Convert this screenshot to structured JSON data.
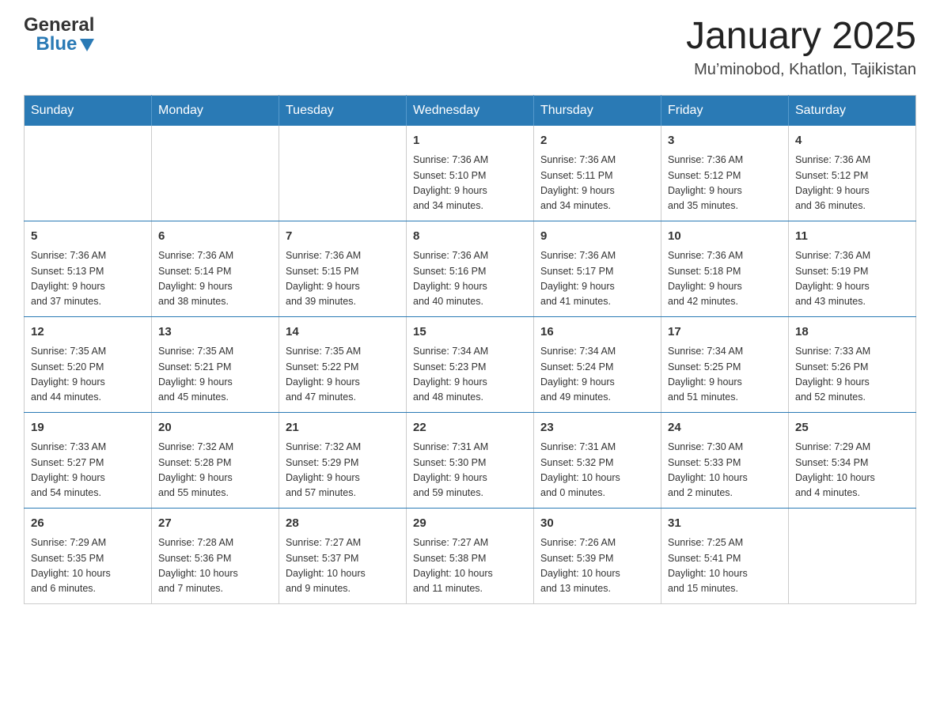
{
  "logo": {
    "general": "General",
    "blue": "Blue"
  },
  "title": "January 2025",
  "subtitle": "Mu’minobod, Khatlon, Tajikistan",
  "days_of_week": [
    "Sunday",
    "Monday",
    "Tuesday",
    "Wednesday",
    "Thursday",
    "Friday",
    "Saturday"
  ],
  "weeks": [
    [
      {
        "day": "",
        "info": ""
      },
      {
        "day": "",
        "info": ""
      },
      {
        "day": "",
        "info": ""
      },
      {
        "day": "1",
        "info": "Sunrise: 7:36 AM\nSunset: 5:10 PM\nDaylight: 9 hours\nand 34 minutes."
      },
      {
        "day": "2",
        "info": "Sunrise: 7:36 AM\nSunset: 5:11 PM\nDaylight: 9 hours\nand 34 minutes."
      },
      {
        "day": "3",
        "info": "Sunrise: 7:36 AM\nSunset: 5:12 PM\nDaylight: 9 hours\nand 35 minutes."
      },
      {
        "day": "4",
        "info": "Sunrise: 7:36 AM\nSunset: 5:12 PM\nDaylight: 9 hours\nand 36 minutes."
      }
    ],
    [
      {
        "day": "5",
        "info": "Sunrise: 7:36 AM\nSunset: 5:13 PM\nDaylight: 9 hours\nand 37 minutes."
      },
      {
        "day": "6",
        "info": "Sunrise: 7:36 AM\nSunset: 5:14 PM\nDaylight: 9 hours\nand 38 minutes."
      },
      {
        "day": "7",
        "info": "Sunrise: 7:36 AM\nSunset: 5:15 PM\nDaylight: 9 hours\nand 39 minutes."
      },
      {
        "day": "8",
        "info": "Sunrise: 7:36 AM\nSunset: 5:16 PM\nDaylight: 9 hours\nand 40 minutes."
      },
      {
        "day": "9",
        "info": "Sunrise: 7:36 AM\nSunset: 5:17 PM\nDaylight: 9 hours\nand 41 minutes."
      },
      {
        "day": "10",
        "info": "Sunrise: 7:36 AM\nSunset: 5:18 PM\nDaylight: 9 hours\nand 42 minutes."
      },
      {
        "day": "11",
        "info": "Sunrise: 7:36 AM\nSunset: 5:19 PM\nDaylight: 9 hours\nand 43 minutes."
      }
    ],
    [
      {
        "day": "12",
        "info": "Sunrise: 7:35 AM\nSunset: 5:20 PM\nDaylight: 9 hours\nand 44 minutes."
      },
      {
        "day": "13",
        "info": "Sunrise: 7:35 AM\nSunset: 5:21 PM\nDaylight: 9 hours\nand 45 minutes."
      },
      {
        "day": "14",
        "info": "Sunrise: 7:35 AM\nSunset: 5:22 PM\nDaylight: 9 hours\nand 47 minutes."
      },
      {
        "day": "15",
        "info": "Sunrise: 7:34 AM\nSunset: 5:23 PM\nDaylight: 9 hours\nand 48 minutes."
      },
      {
        "day": "16",
        "info": "Sunrise: 7:34 AM\nSunset: 5:24 PM\nDaylight: 9 hours\nand 49 minutes."
      },
      {
        "day": "17",
        "info": "Sunrise: 7:34 AM\nSunset: 5:25 PM\nDaylight: 9 hours\nand 51 minutes."
      },
      {
        "day": "18",
        "info": "Sunrise: 7:33 AM\nSunset: 5:26 PM\nDaylight: 9 hours\nand 52 minutes."
      }
    ],
    [
      {
        "day": "19",
        "info": "Sunrise: 7:33 AM\nSunset: 5:27 PM\nDaylight: 9 hours\nand 54 minutes."
      },
      {
        "day": "20",
        "info": "Sunrise: 7:32 AM\nSunset: 5:28 PM\nDaylight: 9 hours\nand 55 minutes."
      },
      {
        "day": "21",
        "info": "Sunrise: 7:32 AM\nSunset: 5:29 PM\nDaylight: 9 hours\nand 57 minutes."
      },
      {
        "day": "22",
        "info": "Sunrise: 7:31 AM\nSunset: 5:30 PM\nDaylight: 9 hours\nand 59 minutes."
      },
      {
        "day": "23",
        "info": "Sunrise: 7:31 AM\nSunset: 5:32 PM\nDaylight: 10 hours\nand 0 minutes."
      },
      {
        "day": "24",
        "info": "Sunrise: 7:30 AM\nSunset: 5:33 PM\nDaylight: 10 hours\nand 2 minutes."
      },
      {
        "day": "25",
        "info": "Sunrise: 7:29 AM\nSunset: 5:34 PM\nDaylight: 10 hours\nand 4 minutes."
      }
    ],
    [
      {
        "day": "26",
        "info": "Sunrise: 7:29 AM\nSunset: 5:35 PM\nDaylight: 10 hours\nand 6 minutes."
      },
      {
        "day": "27",
        "info": "Sunrise: 7:28 AM\nSunset: 5:36 PM\nDaylight: 10 hours\nand 7 minutes."
      },
      {
        "day": "28",
        "info": "Sunrise: 7:27 AM\nSunset: 5:37 PM\nDaylight: 10 hours\nand 9 minutes."
      },
      {
        "day": "29",
        "info": "Sunrise: 7:27 AM\nSunset: 5:38 PM\nDaylight: 10 hours\nand 11 minutes."
      },
      {
        "day": "30",
        "info": "Sunrise: 7:26 AM\nSunset: 5:39 PM\nDaylight: 10 hours\nand 13 minutes."
      },
      {
        "day": "31",
        "info": "Sunrise: 7:25 AM\nSunset: 5:41 PM\nDaylight: 10 hours\nand 15 minutes."
      },
      {
        "day": "",
        "info": ""
      }
    ]
  ]
}
